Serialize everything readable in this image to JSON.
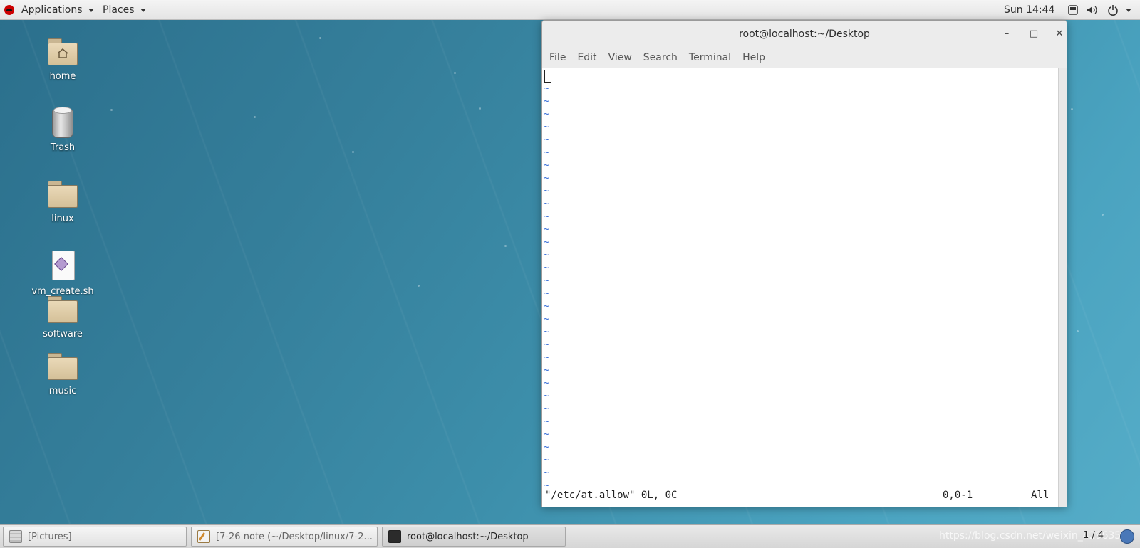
{
  "top_panel": {
    "applications_label": "Applications",
    "places_label": "Places",
    "clock": "Sun 14:44",
    "icons": [
      "redhat-logo-icon",
      "screen-icon",
      "volume-icon",
      "power-icon"
    ]
  },
  "desktop": {
    "icons": [
      {
        "label": "home",
        "icon": "home-folder-icon"
      },
      {
        "label": "Trash",
        "icon": "trash-icon"
      },
      {
        "label": "linux",
        "icon": "folder-icon"
      },
      {
        "label": "vm_create.sh",
        "icon": "script-file-icon"
      },
      {
        "label": "software",
        "icon": "folder-icon"
      },
      {
        "label": "music",
        "icon": "folder-icon"
      }
    ]
  },
  "terminal": {
    "title": "root@localhost:~/Desktop",
    "menu": [
      "File",
      "Edit",
      "View",
      "Search",
      "Terminal",
      "Help"
    ],
    "tilde": "~",
    "status_file": "\"/etc/at.allow\" 0L, 0C",
    "status_position": "0,0-1",
    "status_scroll": "All"
  },
  "taskbar": {
    "tasks": [
      {
        "label": "[Pictures]",
        "icon": "pictures-icon",
        "active": false
      },
      {
        "label": "[7-26 note (~/Desktop/linux/7-2...",
        "icon": "text-editor-icon",
        "active": false
      },
      {
        "label": "root@localhost:~/Desktop",
        "icon": "terminal-icon",
        "active": true
      }
    ],
    "watermark": "https://blog.csdn.net/weixin_42963529",
    "workspace": "1 / 4"
  },
  "colors": {
    "desktop_bg": "#3d8fab",
    "panel_bg": "#e8e8e8",
    "vim_tilde": "#3a6fd8"
  }
}
